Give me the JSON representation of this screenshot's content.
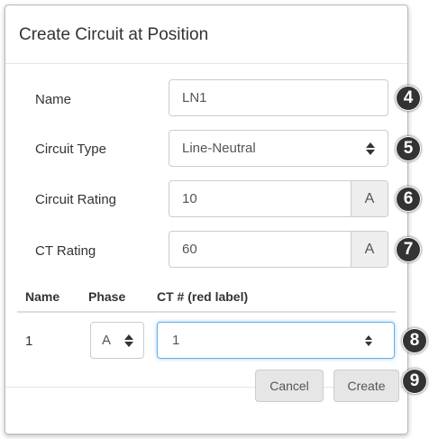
{
  "dialog": {
    "title": "Create Circuit at Position"
  },
  "form": {
    "name": {
      "label": "Name",
      "value": "LN1",
      "badge": "4"
    },
    "circuit_type": {
      "label": "Circuit Type",
      "value": "Line-Neutral",
      "badge": "5"
    },
    "circuit_rating": {
      "label": "Circuit Rating",
      "value": "10",
      "unit": "A",
      "badge": "6"
    },
    "ct_rating": {
      "label": "CT Rating",
      "value": "60",
      "unit": "A",
      "badge": "7"
    }
  },
  "table": {
    "headers": [
      "Name",
      "Phase",
      "CT # (red label)"
    ],
    "row": {
      "name": "1",
      "phase": "A",
      "ct": "1",
      "badge": "8"
    }
  },
  "footer": {
    "cancel_label": "Cancel",
    "create_label": "Create",
    "badge": "9"
  }
}
